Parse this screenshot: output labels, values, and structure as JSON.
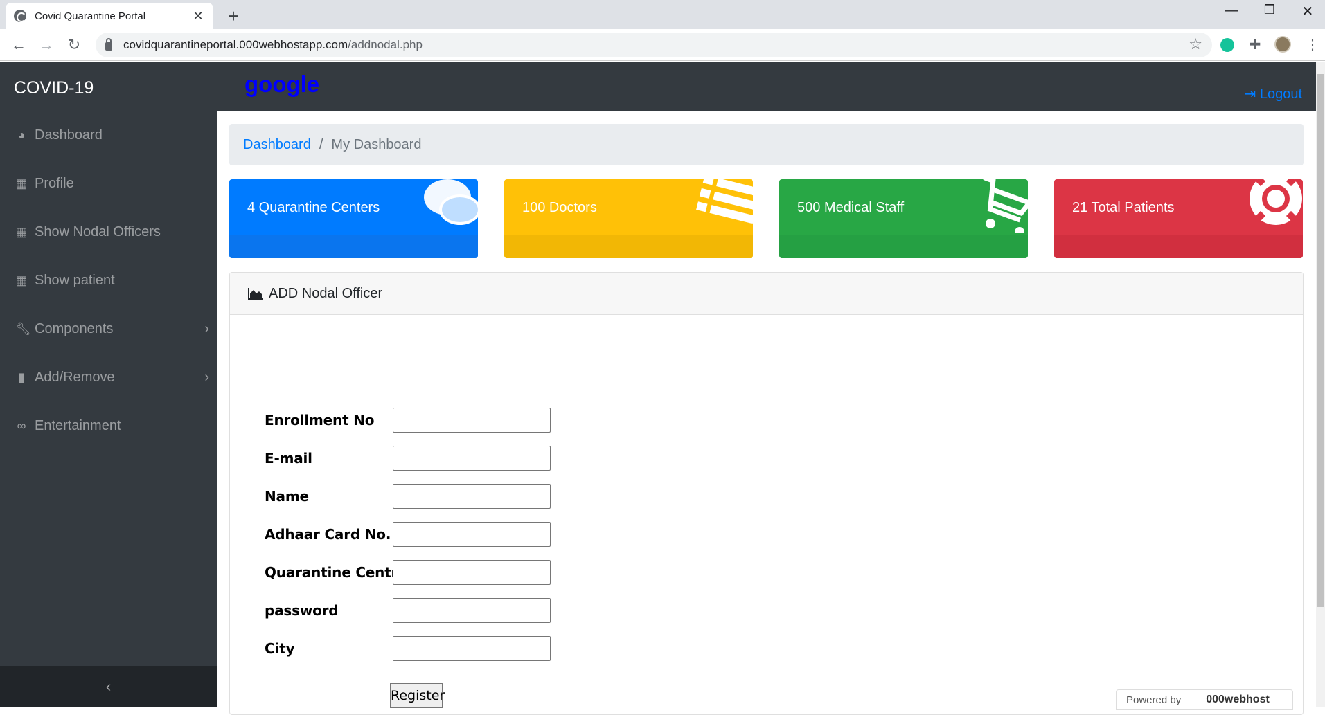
{
  "browser": {
    "tab_title": "Covid Quarantine Portal",
    "url_host": "covidquarantineportal.000webhostapp.com",
    "url_path": "/addnodal.php"
  },
  "sidebar": {
    "brand": "COVID-19",
    "items": [
      {
        "label": "Dashboard",
        "icon": "tachometer-icon"
      },
      {
        "label": "Profile",
        "icon": "table-icon"
      },
      {
        "label": "Show Nodal Officers",
        "icon": "table-icon"
      },
      {
        "label": "Show patient",
        "icon": "table-icon"
      },
      {
        "label": "Components",
        "icon": "wrench-icon"
      },
      {
        "label": "Add/Remove",
        "icon": "file-icon"
      },
      {
        "label": "Entertainment",
        "icon": "link-icon"
      }
    ],
    "toggle": "‹"
  },
  "topnav": {
    "brand_link": "google",
    "logout": "Logout"
  },
  "breadcrumb": {
    "link": "Dashboard",
    "separator": "/",
    "active": "My Dashboard"
  },
  "cards": [
    {
      "text": "4 Quarantine Centers",
      "color": "#007bff",
      "icon": "comments-icon"
    },
    {
      "text": "100 Doctors",
      "color": "#ffc107",
      "icon": "list-icon"
    },
    {
      "text": "500 Medical Staff",
      "color": "#28a745",
      "icon": "shopping-cart-icon"
    },
    {
      "text": "21 Total Patients",
      "color": "#dc3545",
      "icon": "life-ring-icon"
    }
  ],
  "panel": {
    "title": "ADD Nodal Officer"
  },
  "form": {
    "fields": [
      {
        "label": "Enrollment No",
        "value": ""
      },
      {
        "label": "E-mail",
        "value": ""
      },
      {
        "label": "Name",
        "value": ""
      },
      {
        "label": "Adhaar Card No.",
        "value": ""
      },
      {
        "label": "Quarantine Centre",
        "value": ""
      },
      {
        "label": "password",
        "value": ""
      },
      {
        "label": "City",
        "value": ""
      }
    ],
    "submit": "Register"
  },
  "footer_badge": {
    "prefix": "Powered by",
    "brand": "000webhost"
  }
}
